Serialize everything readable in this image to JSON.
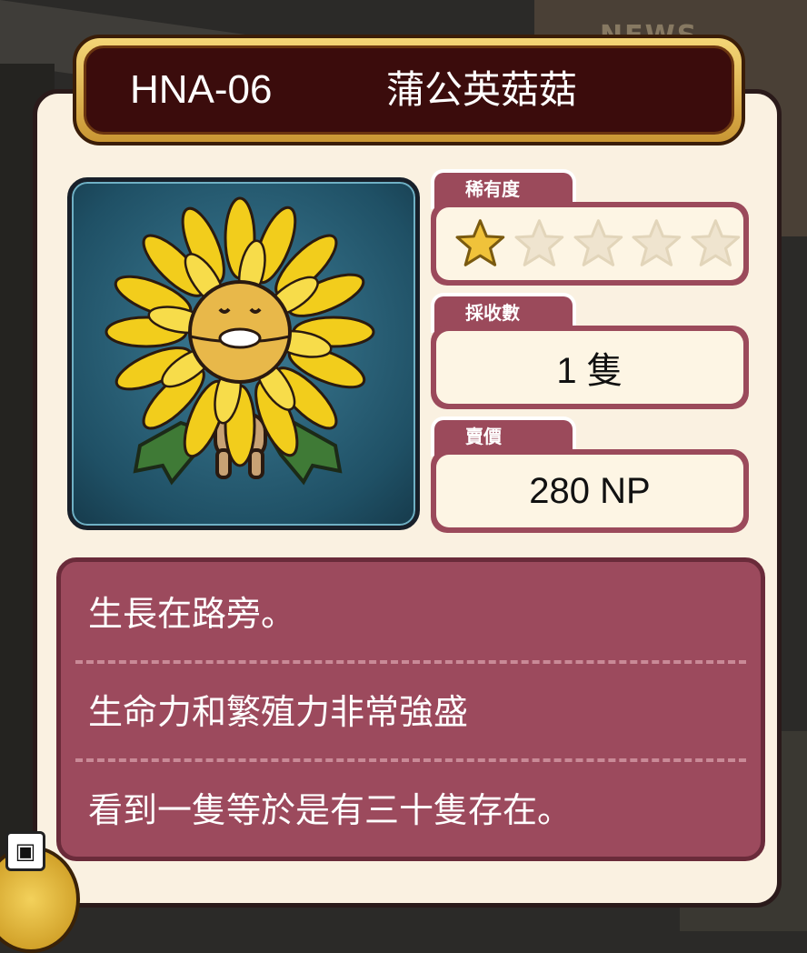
{
  "card": {
    "code": "HNA-06",
    "name": "蒲公英菇菇",
    "portrait_icon": "dandelion-mushroom-character"
  },
  "stats": {
    "rarity_label": "稀有度",
    "rarity_stars_filled": 1,
    "rarity_stars_total": 5,
    "harvest_label": "採收數",
    "harvest_value": "1 隻",
    "price_label": "賣價",
    "price_value": "280 NP"
  },
  "description": {
    "line1": "生長在路旁。",
    "line2": "生命力和繁殖力非常強盛",
    "line3": "看到一隻等於是有三十隻存在。"
  },
  "background": {
    "watermark": "NEWS"
  },
  "colors": {
    "banner_gold": "#e9b94a",
    "banner_dark": "#3b0c0c",
    "accent_rose": "#9b4a5b",
    "card_cream": "#faf1e1",
    "star_filled": "#f0c23a"
  }
}
